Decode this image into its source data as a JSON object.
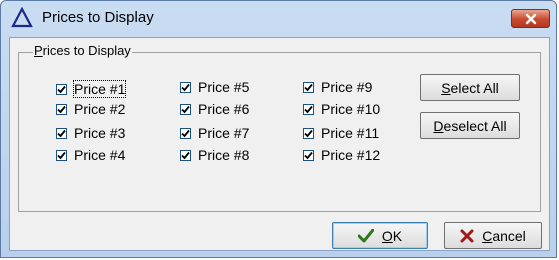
{
  "window": {
    "title": "Prices to Display"
  },
  "group": {
    "label_prefix": "",
    "label_underlined": "P",
    "label_rest": "rices to Display"
  },
  "checkboxes": [
    {
      "label": "Price #1",
      "checked": true
    },
    {
      "label": "Price #2",
      "checked": true
    },
    {
      "label": "Price #3",
      "checked": true
    },
    {
      "label": "Price #4",
      "checked": true
    },
    {
      "label": "Price #5",
      "checked": true
    },
    {
      "label": "Price #6",
      "checked": true
    },
    {
      "label": "Price #7",
      "checked": true
    },
    {
      "label": "Price #8",
      "checked": true
    },
    {
      "label": "Price #9",
      "checked": true
    },
    {
      "label": "Price #10",
      "checked": true
    },
    {
      "label": "Price #11",
      "checked": true
    },
    {
      "label": "Price #12",
      "checked": true
    }
  ],
  "buttons": {
    "select_all": {
      "underlined": "S",
      "rest": "elect All"
    },
    "deselect_all": {
      "underlined": "D",
      "rest": "eselect All"
    },
    "ok": {
      "underlined": "O",
      "rest": "K"
    },
    "cancel": {
      "underlined": "C",
      "rest": "ancel"
    }
  },
  "icons": {
    "app": "triangle-icon",
    "close": "close-icon",
    "ok": "checkmark-icon",
    "cancel": "x-icon"
  },
  "colors": {
    "check_mark": "#000000",
    "ok_icon": "#2a7a1a",
    "cancel_icon": "#a01818",
    "close_button": "#c84a30"
  }
}
